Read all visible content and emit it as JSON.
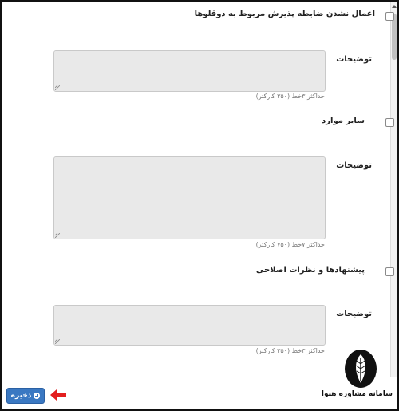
{
  "sections": [
    {
      "checkbox_label": "اعمال نشدن ضابطه پذیرش مربوط به دوقلوها",
      "field_label": "توضیحات",
      "textarea_value": "",
      "hint": "حداکثر ۳خط (۳۵۰ کارکتر)"
    },
    {
      "checkbox_label": "سایر موارد",
      "field_label": "توضیحات",
      "textarea_value": "",
      "hint": "حداکثر ۷خط (۷۵۰ کارکتر)"
    },
    {
      "checkbox_label": "پیشنهادها و نظرات اصلاحی",
      "field_label": "توضیحات",
      "textarea_value": "",
      "hint": "حداکثر ۳خط (۳۵۰ کارکتر)"
    }
  ],
  "footer": {
    "save_label": "ذخیره",
    "save_icon": "plus-circle-icon",
    "arrow_icon": "red-arrow-icon",
    "arrow_color": "#e31e1e"
  },
  "watermark": {
    "text": "سامانه مشاوره هیوا",
    "icon": "feather-logo-icon"
  },
  "colors": {
    "primary_button": "#3a78c2",
    "textarea_bg": "#e9e9e9"
  }
}
